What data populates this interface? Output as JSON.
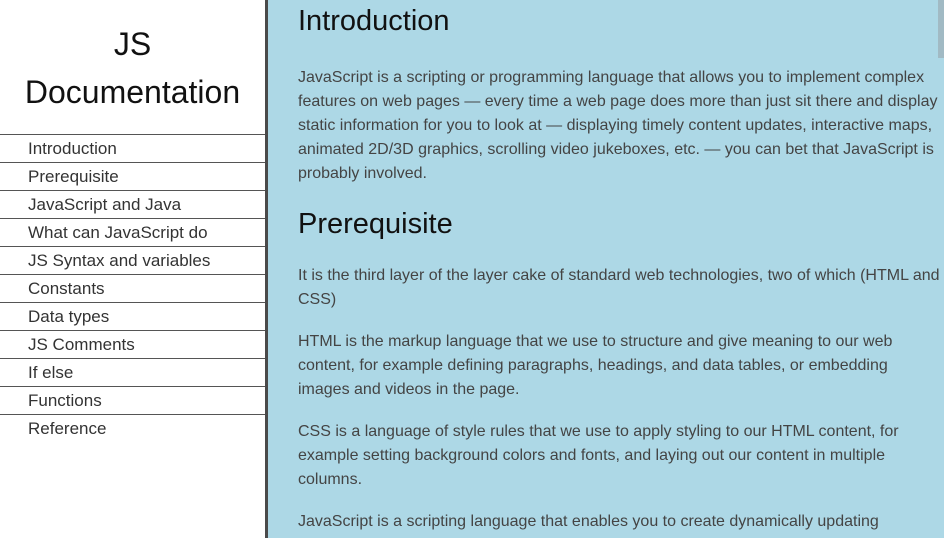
{
  "nav": {
    "title_line1": "JS",
    "title_line2": "Documentation",
    "items": [
      {
        "label": "Introduction"
      },
      {
        "label": "Prerequisite"
      },
      {
        "label": "JavaScript and Java"
      },
      {
        "label": "What can JavaScript do"
      },
      {
        "label": "JS Syntax and variables"
      },
      {
        "label": "Constants"
      },
      {
        "label": "Data types"
      },
      {
        "label": "JS Comments"
      },
      {
        "label": "If else"
      },
      {
        "label": "Functions"
      },
      {
        "label": "Reference"
      }
    ]
  },
  "main": {
    "introduction": {
      "heading": "Introduction",
      "paragraphs": [
        "JavaScript is a scripting or programming language that allows you to implement complex features on web pages — every time a web page does more than just sit there and display static information for you to look at — displaying timely content updates, interactive maps, animated 2D/3D graphics, scrolling video jukeboxes, etc. — you can bet that JavaScript is probably involved."
      ]
    },
    "prerequisite": {
      "heading": "Prerequisite",
      "paragraphs": [
        "It is the third layer of the layer cake of standard web technologies, two of which (HTML and CSS)",
        "HTML is the markup language that we use to structure and give meaning to our web content, for example defining paragraphs, headings, and data tables, or embedding images and videos in the page.",
        "CSS is a language of style rules that we use to apply styling to our HTML content, for example setting background colors and fonts, and laying out our content in multiple columns.",
        "JavaScript is a scripting language that enables you to create dynamically updating content,"
      ]
    }
  },
  "colors": {
    "main_background": "#add8e6",
    "nav_background": "#ffffff",
    "nav_border": "#4a4a4a"
  }
}
